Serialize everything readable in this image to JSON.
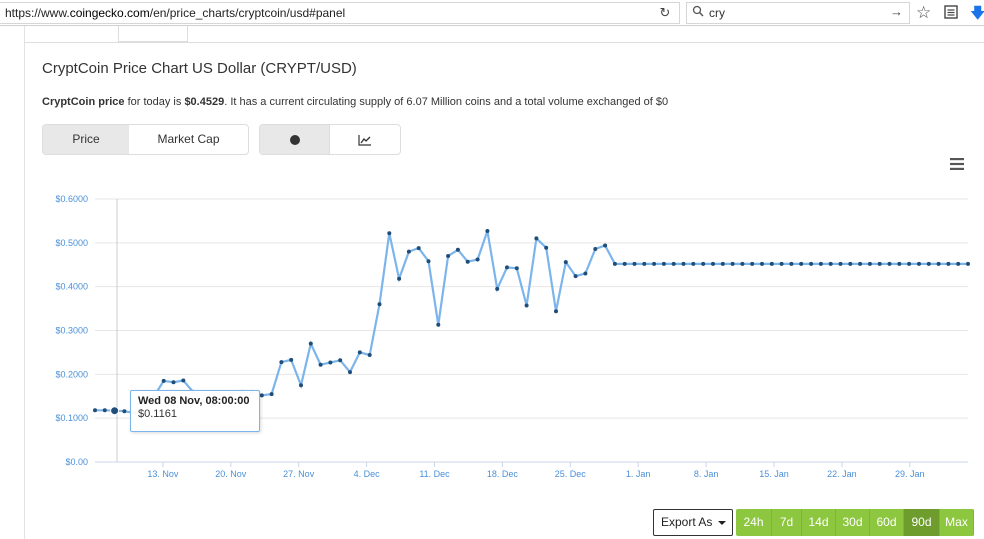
{
  "browser": {
    "url_prefix": "https://www.",
    "url_host": "coingecko.com",
    "url_path": "/en/price_charts/cryptcoin/usd#panel",
    "search_value": "cry"
  },
  "page": {
    "title": "CryptCoin Price Chart US Dollar (CRYPT/USD)",
    "desc_coin": "CryptCoin price",
    "desc_mid": " for today is ",
    "desc_price": "$0.4529",
    "desc_rest": ". It has a current circulating supply of 6.07 Million coins and a total volume exchanged of $0"
  },
  "toggles": {
    "metric": [
      {
        "label": "Price",
        "active": true
      },
      {
        "label": "Market Cap",
        "active": false
      }
    ],
    "style": [
      {
        "icon": "dot-icon",
        "active": true
      },
      {
        "icon": "line-chart-icon",
        "active": false
      }
    ]
  },
  "tooltip": {
    "date": "Wed 08 Nov, 08:00:00",
    "value": "$0.1161"
  },
  "controls": {
    "export_label": "Export As",
    "ranges": [
      {
        "label": "24h",
        "active": false
      },
      {
        "label": "7d",
        "active": false
      },
      {
        "label": "14d",
        "active": false
      },
      {
        "label": "30d",
        "active": false
      },
      {
        "label": "60d",
        "active": false
      },
      {
        "label": "90d",
        "active": true
      },
      {
        "label": "Max",
        "active": false
      }
    ]
  },
  "colors": {
    "line": "#7cb5ec",
    "marker": "#1f4e79",
    "accent": "#8dc63f"
  },
  "chart_data": {
    "type": "line",
    "title": "",
    "xlabel": "",
    "ylabel": "",
    "ylim": [
      0,
      0.6
    ],
    "yticks": [
      "$0.00",
      "$0.1000",
      "$0.2000",
      "$0.3000",
      "$0.4000",
      "$0.5000",
      "$0.6000"
    ],
    "yticks_values": [
      0,
      0.1,
      0.2,
      0.3,
      0.4,
      0.5,
      0.6
    ],
    "xticks": [
      "13. Nov",
      "20. Nov",
      "27. Nov",
      "4. Dec",
      "11. Dec",
      "18. Dec",
      "25. Dec",
      "1. Jan",
      "8. Jan",
      "15. Jan",
      "22. Jan",
      "29. Jan"
    ],
    "x_start": "2017-11-06",
    "x_end": "2018-02-04",
    "grid": true,
    "series": [
      {
        "values": [
          0.118,
          0.118,
          0.117,
          0.116,
          0.112,
          0.135,
          0.15,
          0.185,
          0.182,
          0.186,
          0.16,
          0.14,
          0.13,
          0.15,
          0.158,
          0.16,
          0.158,
          0.152,
          0.155,
          0.228,
          0.233,
          0.175,
          0.27,
          0.222,
          0.227,
          0.232,
          0.205,
          0.25,
          0.244,
          0.36,
          0.522,
          0.418,
          0.48,
          0.488,
          0.458,
          0.313,
          0.47,
          0.484,
          0.457,
          0.462,
          0.527,
          0.395,
          0.444,
          0.442,
          0.357,
          0.51,
          0.489,
          0.344,
          0.456,
          0.424,
          0.43,
          0.486,
          0.494,
          0.452,
          0.452,
          0.452,
          0.452,
          0.452,
          0.452,
          0.452,
          0.452,
          0.452,
          0.452,
          0.452,
          0.452,
          0.452,
          0.452,
          0.452,
          0.452,
          0.452,
          0.452,
          0.452,
          0.452,
          0.452,
          0.452,
          0.452,
          0.452,
          0.452,
          0.452,
          0.452,
          0.452,
          0.452,
          0.452,
          0.452,
          0.452,
          0.452,
          0.452,
          0.452,
          0.452,
          0.452
        ]
      }
    ]
  }
}
